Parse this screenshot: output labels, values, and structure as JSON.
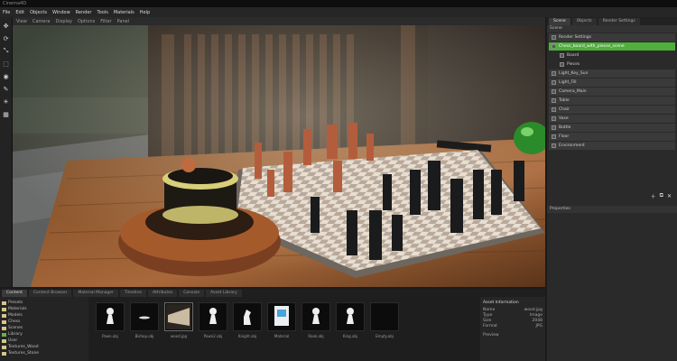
{
  "window": {
    "title": "Cinema4D"
  },
  "menu": {
    "items": [
      "File",
      "Edit",
      "Objects",
      "Window",
      "Render",
      "Tools",
      "Materials",
      "Help"
    ]
  },
  "viewport_toolbar": {
    "items": [
      "View",
      "Camera",
      "Display",
      "Options",
      "Filter",
      "Panel"
    ]
  },
  "right_panel": {
    "tabs": [
      {
        "label": "Scene",
        "active": true
      },
      {
        "label": "Objects",
        "active": false
      },
      {
        "label": "Render Settings",
        "active": false
      }
    ],
    "header": "Scene",
    "rows": [
      {
        "label": "Render Settings",
        "type": "row",
        "selected": false
      },
      {
        "label": "Chess_board_with_pieces_scene",
        "type": "row",
        "selected": true
      },
      {
        "label": "Board",
        "type": "child",
        "selected": false
      },
      {
        "label": "Pieces",
        "type": "child",
        "selected": false
      },
      {
        "label": "Light_Key_Sun",
        "type": "row",
        "selected": false
      },
      {
        "label": "Light_Fill",
        "type": "row",
        "selected": false
      },
      {
        "label": "Camera_Main",
        "type": "row",
        "selected": false
      },
      {
        "label": "Table",
        "type": "row",
        "selected": false
      },
      {
        "label": "Chair",
        "type": "row",
        "selected": false
      },
      {
        "label": "Vase",
        "type": "row",
        "selected": false
      },
      {
        "label": "Bottle",
        "type": "row",
        "selected": false
      },
      {
        "label": "Floor",
        "type": "row",
        "selected": false
      },
      {
        "label": "Environment",
        "type": "row",
        "selected": false
      }
    ],
    "footer_icons": [
      "add-icon",
      "duplicate-icon",
      "delete-icon"
    ],
    "properties_header": "Properties"
  },
  "bottom": {
    "tabs": [
      {
        "label": "Content",
        "active": true
      },
      {
        "label": "Content Browser",
        "active": false
      },
      {
        "label": "Material Manager",
        "active": false
      },
      {
        "label": "Timeline",
        "active": false
      },
      {
        "label": "Attributes",
        "active": false
      },
      {
        "label": "Console",
        "active": false
      },
      {
        "label": "Asset Library",
        "active": false
      }
    ],
    "tree": [
      {
        "label": "Presets",
        "green": false
      },
      {
        "label": "Materials",
        "green": false
      },
      {
        "label": "Models",
        "green": false
      },
      {
        "label": "Chess",
        "green": false
      },
      {
        "label": "Scenes",
        "green": false
      },
      {
        "label": "Library",
        "green": true
      },
      {
        "label": "User",
        "green": false
      },
      {
        "label": "Textures_Wood",
        "green": false
      },
      {
        "label": "Textures_Stone",
        "green": false
      }
    ],
    "assets": [
      {
        "label": "Pawn.obj",
        "kind": "pawn",
        "selected": false
      },
      {
        "label": "Bishop.obj",
        "kind": "flat",
        "selected": false
      },
      {
        "label": "wood.jpg",
        "kind": "wood",
        "selected": true
      },
      {
        "label": "Pawn2.obj",
        "kind": "pawn",
        "selected": false
      },
      {
        "label": "Knight.obj",
        "kind": "knight",
        "selected": false
      },
      {
        "label": "Material",
        "kind": "material",
        "selected": false
      },
      {
        "label": "Rook.obj",
        "kind": "pawn",
        "selected": false
      },
      {
        "label": "King.obj",
        "kind": "pawn",
        "selected": false
      },
      {
        "label": "Empty.obj",
        "kind": "empty",
        "selected": false
      }
    ],
    "info": {
      "header": "Asset Information",
      "rows": [
        {
          "key": "Name",
          "value": "wood.jpg"
        },
        {
          "key": "Type",
          "value": "Image"
        },
        {
          "key": "Size",
          "value": "2048"
        },
        {
          "key": "Format",
          "value": "JPG"
        }
      ],
      "preview_label": "Preview"
    }
  },
  "colors": {
    "accent_green": "#4fae3c",
    "panel_bg": "#2a2a2a",
    "folder_yellow": "#d7c58a"
  }
}
